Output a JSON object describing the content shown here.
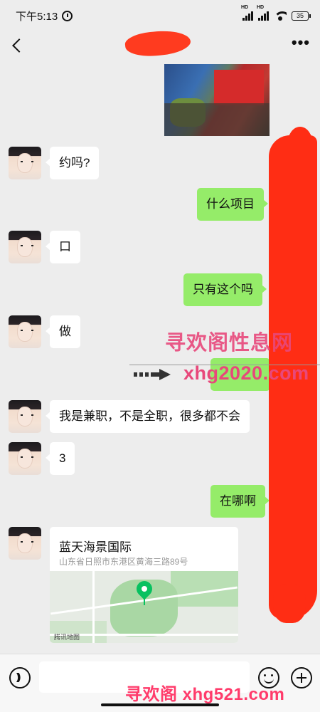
{
  "status_bar": {
    "time": "下午5:13",
    "signal1": "HD",
    "signal2": "HD",
    "battery": "35"
  },
  "header": {
    "more": "•••"
  },
  "messages": [
    {
      "side": "in",
      "text": "约吗?"
    },
    {
      "side": "out",
      "text": "什么项目"
    },
    {
      "side": "in",
      "text": "口"
    },
    {
      "side": "out",
      "text": "只有这个吗"
    },
    {
      "side": "in",
      "text": "做"
    },
    {
      "side": "in",
      "text": "我是兼职，不是全职，很多都不会"
    },
    {
      "side": "in",
      "text": "3"
    },
    {
      "side": "out",
      "text": "在哪啊"
    }
  ],
  "location": {
    "name": "蓝天海景国际",
    "address": "山东省日照市东港区黄海三路89号",
    "map_brand": "腾讯地图"
  },
  "watermarks": {
    "line1": "寻欢阁性息网",
    "line2": "xhg2020.com",
    "bottom": "寻欢阁 xhg521.com"
  }
}
